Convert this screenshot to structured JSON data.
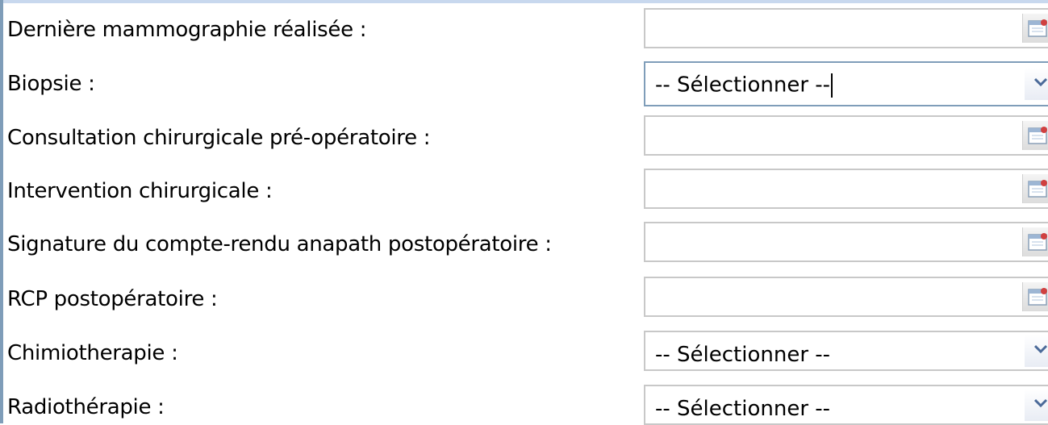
{
  "form": {
    "rows": [
      {
        "label": "Dernière mammographie réalisée :",
        "type": "date",
        "value": "",
        "icon": "calendar-icon"
      },
      {
        "label": "Biopsie :",
        "type": "select",
        "value": "-- Sélectionner --",
        "focused": true,
        "icon": "chevron-down-icon"
      },
      {
        "label": "Consultation chirurgicale pré-opératoire :",
        "type": "date",
        "value": "",
        "icon": "calendar-icon"
      },
      {
        "label": "Intervention chirurgicale :",
        "type": "date",
        "value": "",
        "icon": "calendar-icon"
      },
      {
        "label": "Signature du compte-rendu anapath postopératoire :",
        "type": "date",
        "value": "",
        "icon": "calendar-icon"
      },
      {
        "label": "RCP postopératoire :",
        "type": "date",
        "value": "",
        "icon": "calendar-icon"
      },
      {
        "label": "Chimiotherapie :",
        "type": "select",
        "value": "-- Sélectionner --",
        "icon": "chevron-down-icon"
      },
      {
        "label": "Radiothérapie :",
        "type": "select",
        "value": "-- Sélectionner --",
        "icon": "chevron-down-icon"
      }
    ]
  },
  "colors": {
    "border": "#c8c8c8",
    "focus_border": "#7f9db9",
    "frame_border": "#7f9db9"
  }
}
